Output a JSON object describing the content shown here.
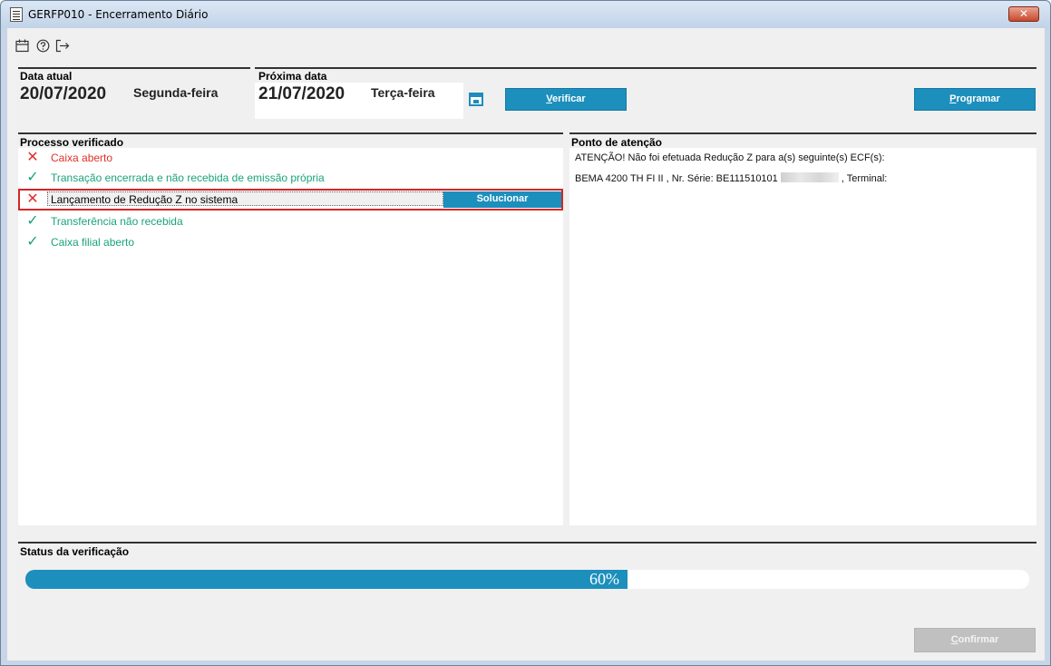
{
  "window": {
    "title": "GERFP010 - Encerramento Diário",
    "close_label": "✕"
  },
  "toolbar": {
    "icons": [
      "calendar-icon",
      "help-icon",
      "exit-icon"
    ]
  },
  "current": {
    "label": "Data atual",
    "date": "20/07/2020",
    "weekday": "Segunda-feira"
  },
  "next": {
    "label": "Próxima data",
    "date": "21/07/2020",
    "weekday": "Terça-feira"
  },
  "buttons": {
    "verify_prefix": "V",
    "verify_rest": "erificar",
    "program_prefix": "P",
    "program_rest": "rogramar",
    "solve": "Solucionar",
    "confirm_prefix": "C",
    "confirm_rest": "onfirmar"
  },
  "process": {
    "title": "Processo verificado",
    "items": [
      {
        "status": "error",
        "text": "Caixa aberto"
      },
      {
        "status": "ok",
        "text": "Transação encerrada e não recebida de emissão própria"
      },
      {
        "status": "error-selected",
        "text": "Lançamento de Redução Z no sistema"
      },
      {
        "status": "ok",
        "text": "Transferência não recebida"
      },
      {
        "status": "ok",
        "text": "Caixa filial aberto"
      }
    ]
  },
  "attention": {
    "title": "Ponto de atenção",
    "line1": "ATENÇÃO! Não foi efetuada Redução Z para a(s) seguinte(s) ECF(s):",
    "line2_a": "BEMA 4200 TH FI II , Nr. Série: BE111510101",
    "line2_b": ", Terminal:"
  },
  "status": {
    "title": "Status da verificação",
    "progress": 0.6,
    "progress_text": "60%"
  },
  "colors": {
    "accent": "#1c8fbd",
    "ok": "#1aa37a",
    "error": "#e0302a"
  }
}
